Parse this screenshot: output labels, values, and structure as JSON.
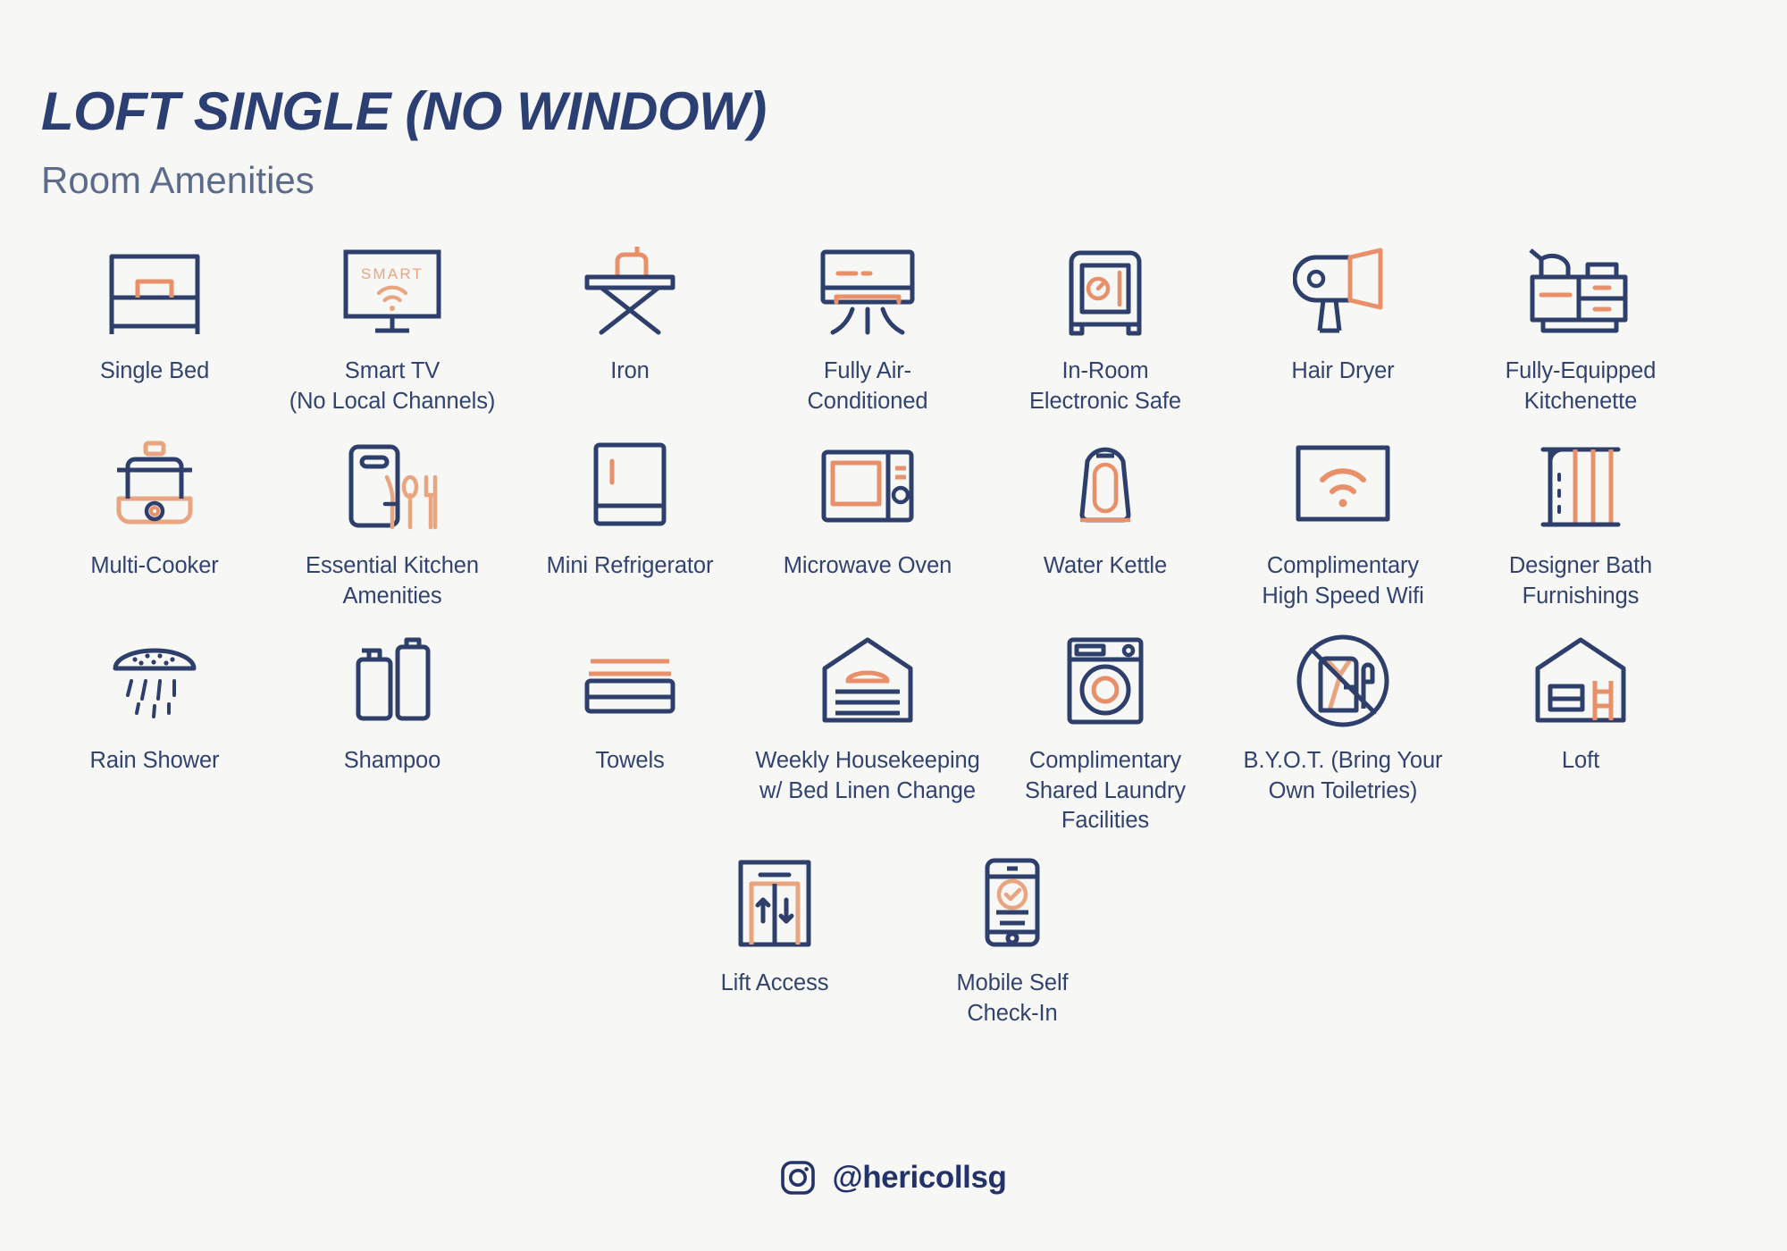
{
  "header": {
    "title": "LOFT SINGLE (NO WINDOW)",
    "subtitle": "Room Amenities"
  },
  "colors": {
    "background": "#f7f7f5",
    "navy": "#2e3f6b",
    "title_navy": "#2b3f72",
    "subtitle_grey": "#5c6b8a",
    "orange": "#e8906a",
    "orange_light": "#f0a98a"
  },
  "rows": [
    {
      "items": [
        {
          "icon": "single-bed-icon",
          "label": "Single Bed"
        },
        {
          "icon": "smart-tv-icon",
          "label": "Smart TV\n(No Local Channels)",
          "icon_text": "SMART"
        },
        {
          "icon": "iron-icon",
          "label": "Iron"
        },
        {
          "icon": "air-conditioner-icon",
          "label": "Fully Air-\nConditioned"
        },
        {
          "icon": "safe-icon",
          "label": "In-Room\nElectronic Safe"
        },
        {
          "icon": "hair-dryer-icon",
          "label": "Hair Dryer"
        },
        {
          "icon": "kitchenette-icon",
          "label": "Fully-Equipped\nKitchenette"
        }
      ]
    },
    {
      "items": [
        {
          "icon": "multi-cooker-icon",
          "label": "Multi-Cooker"
        },
        {
          "icon": "kitchen-utensils-icon",
          "label": "Essential Kitchen\nAmenities"
        },
        {
          "icon": "mini-refrigerator-icon",
          "label": "Mini Refrigerator"
        },
        {
          "icon": "microwave-oven-icon",
          "label": "Microwave Oven"
        },
        {
          "icon": "water-kettle-icon",
          "label": "Water Kettle"
        },
        {
          "icon": "wifi-icon",
          "label": "Complimentary\nHigh Speed Wifi"
        },
        {
          "icon": "bath-furnishings-icon",
          "label": "Designer Bath\nFurnishings"
        }
      ]
    },
    {
      "items": [
        {
          "icon": "rain-shower-icon",
          "label": "Rain Shower"
        },
        {
          "icon": "shampoo-icon",
          "label": "Shampoo"
        },
        {
          "icon": "towels-icon",
          "label": "Towels"
        },
        {
          "icon": "housekeeping-icon",
          "label": "Weekly Housekeeping\nw/ Bed Linen Change"
        },
        {
          "icon": "laundry-icon",
          "label": "Complimentary\nShared Laundry\nFacilities"
        },
        {
          "icon": "no-toiletries-icon",
          "label": "B.Y.O.T. (Bring Your\nOwn Toiletries)"
        },
        {
          "icon": "loft-icon",
          "label": "Loft"
        }
      ]
    },
    {
      "items": [
        {
          "icon": "lift-icon",
          "label": "Lift Access"
        },
        {
          "icon": "mobile-checkin-icon",
          "label": "Mobile Self\nCheck-In"
        }
      ]
    }
  ],
  "footer": {
    "icon": "instagram-icon",
    "handle": "@hericollsg"
  }
}
